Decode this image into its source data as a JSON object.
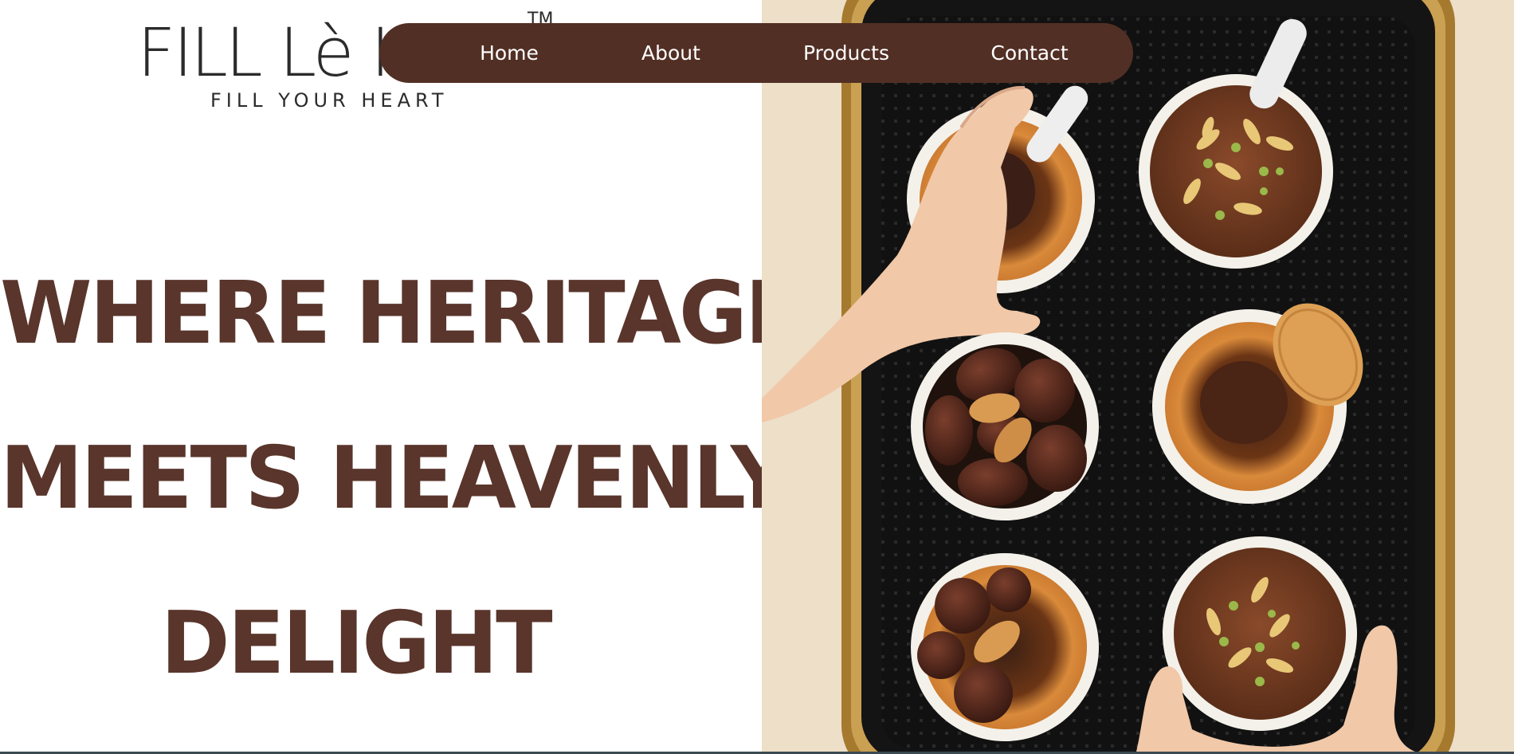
{
  "logo": {
    "wordmark": "FILL Lè HEART",
    "trademark": "TM",
    "tagline": "FILL YOUR HEART"
  },
  "nav": {
    "items": [
      {
        "id": "home",
        "label": "Home"
      },
      {
        "id": "about",
        "label": "About"
      },
      {
        "id": "products",
        "label": "Products"
      },
      {
        "id": "contact",
        "label": "Contact"
      }
    ]
  },
  "hero": {
    "headline_lines": [
      "WHERE HERITAGE",
      "MEETS HEAVENLY",
      "DELIGHT"
    ]
  },
  "colors": {
    "brand_brown": "#522f24",
    "headline_brown": "#59352b",
    "tray_gold": "#b8893a",
    "tray_black": "#141414",
    "wall_cream": "#efe2cc"
  }
}
